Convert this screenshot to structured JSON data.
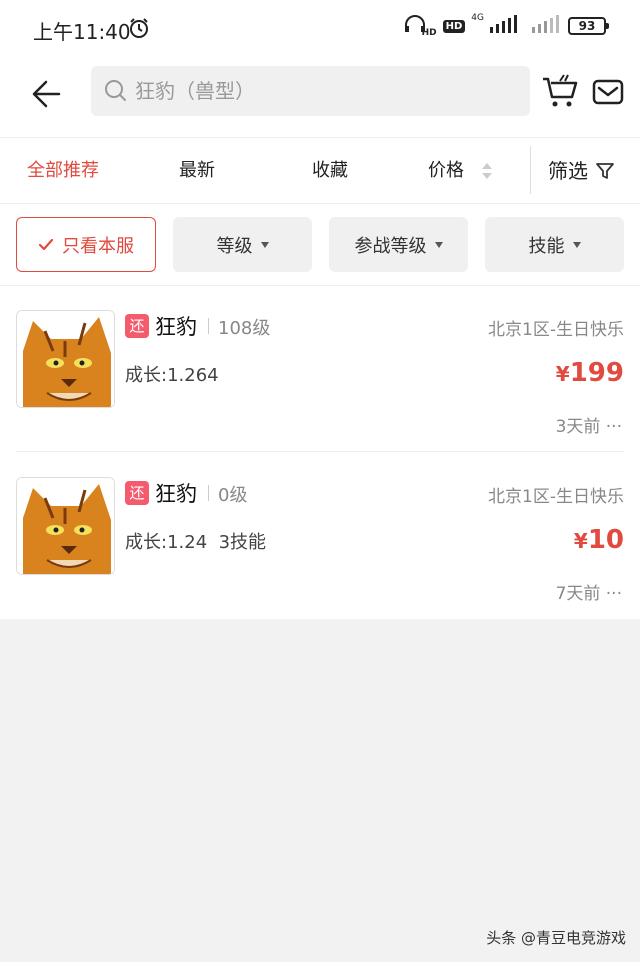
{
  "status_bar": {
    "time": "上午11:40",
    "hd_label": "HD",
    "hd_box": "HD",
    "network": "4G",
    "battery": "93"
  },
  "header": {
    "search_placeholder": "狂豹（兽型）"
  },
  "sort_tabs": [
    {
      "label": "全部推荐",
      "active": true
    },
    {
      "label": "最新",
      "active": false
    },
    {
      "label": "收藏",
      "active": false
    },
    {
      "label": "价格",
      "active": false
    }
  ],
  "filter_label": "筛选",
  "filter_chips": [
    {
      "label": "只看本服",
      "selected": true
    },
    {
      "label": "等级",
      "selected": false
    },
    {
      "label": "参战等级",
      "selected": false
    },
    {
      "label": "技能",
      "selected": false
    }
  ],
  "listings": [
    {
      "badge": "还",
      "name": "狂豹",
      "level": "108级",
      "server": "北京1区-生日快乐",
      "growth": "成长:1.264",
      "price_symbol": "¥",
      "price": "199",
      "time": "3天前 ···"
    },
    {
      "badge": "还",
      "name": "狂豹",
      "level": "0级",
      "server": "北京1区-生日快乐",
      "growth": "成长:1.24  3技能",
      "price_symbol": "¥",
      "price": "10",
      "time": "7天前 ···"
    }
  ],
  "watermark": "头条 @青豆电竞游戏",
  "colors": {
    "accent": "#e04a3f",
    "badge": "#f45b6c",
    "page_bg": "#f2f2f2"
  }
}
